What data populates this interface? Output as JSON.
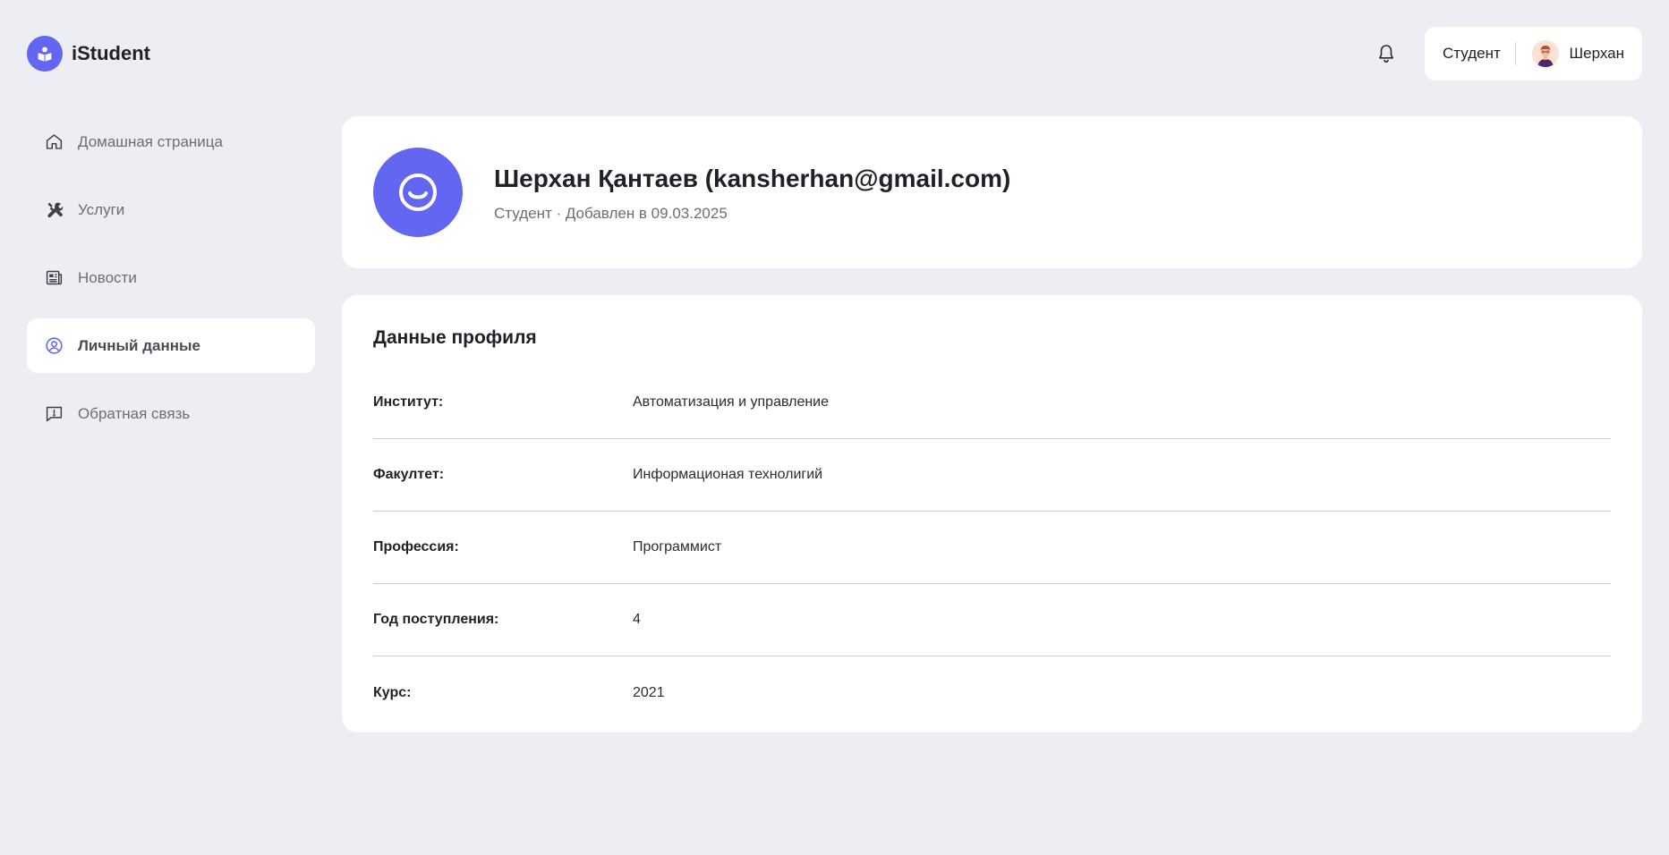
{
  "app": {
    "name": "iStudent"
  },
  "header": {
    "role": "Студент",
    "user_name": "Шерхан"
  },
  "sidebar": {
    "items": [
      {
        "label": "Домашная страница",
        "icon": "home-icon",
        "active": false
      },
      {
        "label": "Услуги",
        "icon": "tools-icon",
        "active": false
      },
      {
        "label": "Новости",
        "icon": "news-icon",
        "active": false
      },
      {
        "label": "Личный данные",
        "icon": "user-circle-icon",
        "active": true
      },
      {
        "label": "Обратная связь",
        "icon": "feedback-icon",
        "active": false
      }
    ]
  },
  "profile": {
    "full_name": "Шерхан Қантаев (kansherhan@gmail.com)",
    "subline": "Студент · Добавлен в 09.03.2025"
  },
  "profile_data": {
    "title": "Данные профиля",
    "rows": [
      {
        "label": "Институт:",
        "value": "Автоматизация и управление"
      },
      {
        "label": "Факултет:",
        "value": "Информационая технолигий"
      },
      {
        "label": "Профессия:",
        "value": "Программист"
      },
      {
        "label": "Год поступления:",
        "value": "4"
      },
      {
        "label": "Курс:",
        "value": "2021"
      }
    ]
  },
  "colors": {
    "accent": "#6366f1",
    "background": "#eceef3",
    "card": "#ffffff"
  }
}
